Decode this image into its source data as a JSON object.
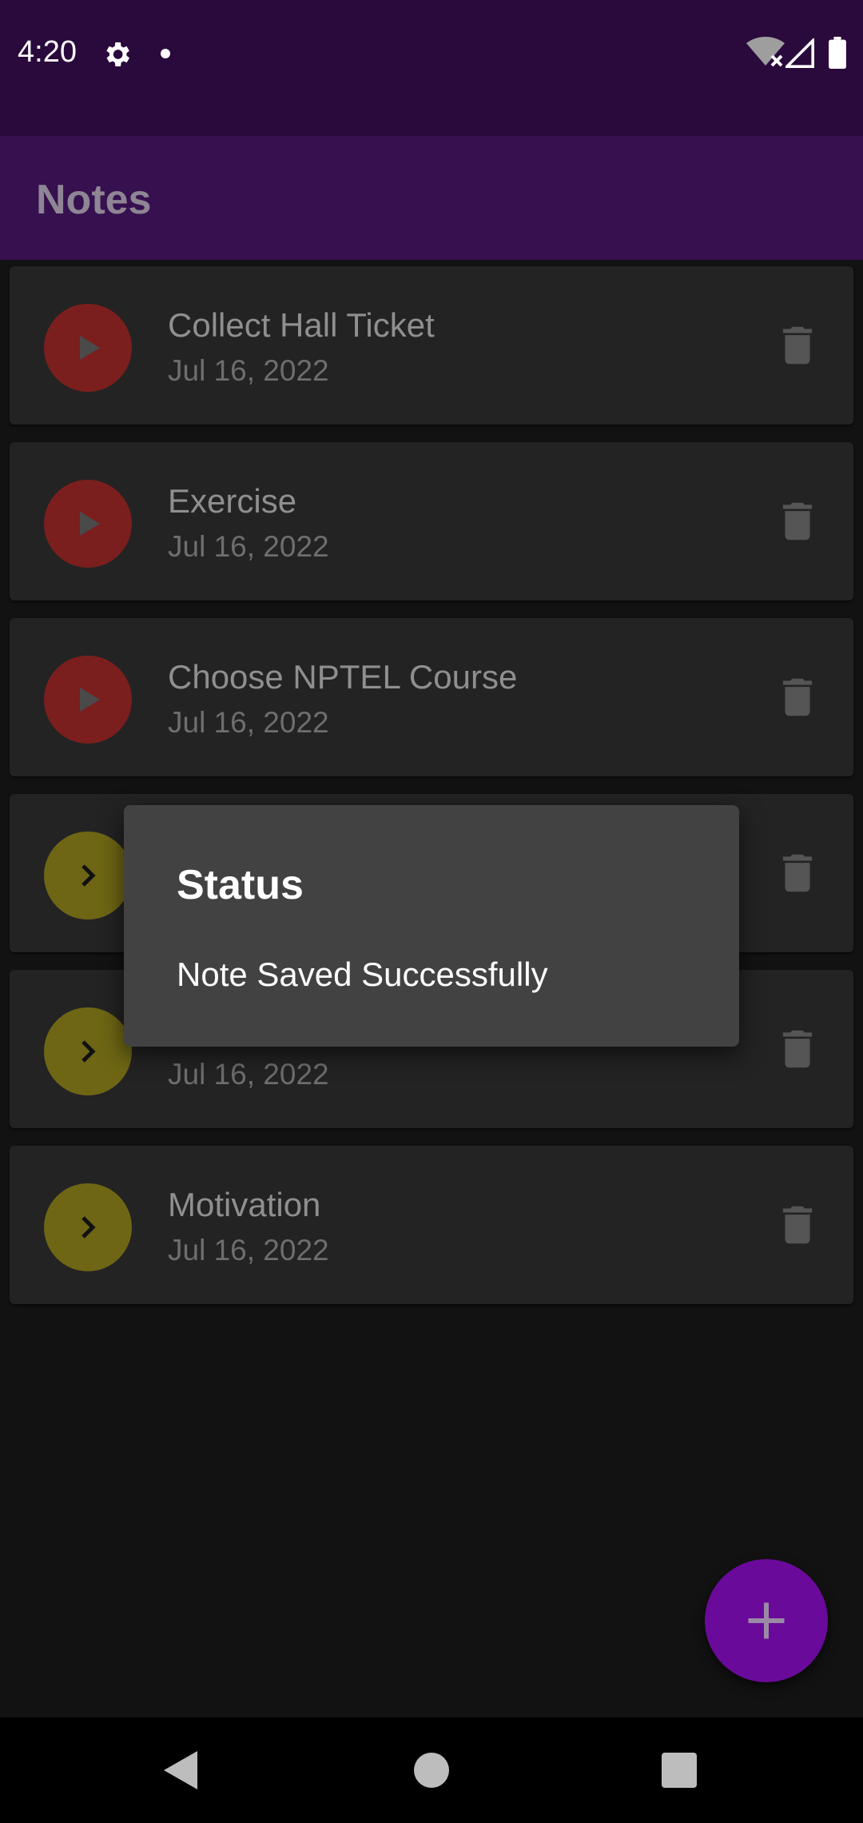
{
  "status_bar": {
    "time": "4:20",
    "icons": [
      "settings-icon",
      "notification-dot-icon",
      "wifi-off-icon",
      "signal-icon",
      "battery-icon"
    ]
  },
  "app_bar": {
    "title": "Notes",
    "background": "#36104f"
  },
  "notes": [
    {
      "title": "Collect Hall Ticket",
      "date": "Jul 16, 2022",
      "status_color": "#7a1f1d",
      "icon": "play-icon"
    },
    {
      "title": "Exercise",
      "date": "Jul 16, 2022",
      "status_color": "#7a1f1d",
      "icon": "play-icon"
    },
    {
      "title": "Choose NPTEL Course",
      "date": "Jul 16, 2022",
      "status_color": "#7a1f1d",
      "icon": "play-icon"
    },
    {
      "title": "",
      "date": "",
      "status_color": "#6e6614",
      "icon": "chevron-right-icon"
    },
    {
      "title": "",
      "date": "Jul 16, 2022",
      "status_color": "#6e6614",
      "icon": "chevron-right-icon"
    },
    {
      "title": "Motivation",
      "date": "Jul 16, 2022",
      "status_color": "#6e6614",
      "icon": "chevron-right-icon"
    }
  ],
  "dialog": {
    "title": "Status",
    "message": "Note Saved Successfully"
  },
  "fab": {
    "icon": "plus-icon",
    "color": "#6a0a9a"
  },
  "nav_bar": {
    "icons": [
      "back-icon",
      "home-icon",
      "recents-icon"
    ]
  }
}
